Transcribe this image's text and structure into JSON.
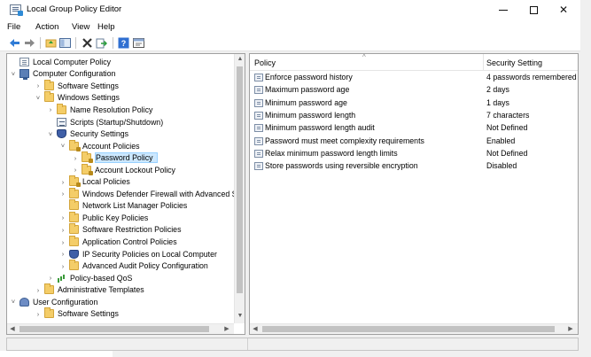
{
  "window": {
    "title": "Local Group Policy Editor",
    "controls": {
      "minimize": "–",
      "close": "✕"
    }
  },
  "menu": [
    "File",
    "Action",
    "View",
    "Help"
  ],
  "toolbar": {
    "icons": [
      "back-arrow-icon",
      "forward-arrow-icon",
      "up-folder-icon",
      "show-hide-tree-icon",
      "delete-icon",
      "export-list-icon",
      "help-icon",
      "properties-icon"
    ],
    "colors": {
      "arrow": "#2f7bd6",
      "help": "#2f6fd1",
      "delete": "#333333"
    }
  },
  "tree": [
    {
      "label": "Local Computer Policy",
      "chevron": "",
      "icon": "doc"
    },
    {
      "label": "Computer Configuration",
      "chevron": "˅",
      "icon": "computer"
    },
    {
      "label": "Software Settings",
      "chevron": "›",
      "icon": "folder"
    },
    {
      "label": "Windows Settings",
      "chevron": "˅",
      "icon": "folder"
    },
    {
      "label": "Name Resolution Policy",
      "chevron": "›",
      "icon": "folder"
    },
    {
      "label": "Scripts (Startup/Shutdown)",
      "chevron": "",
      "icon": "scripts"
    },
    {
      "label": "Security Settings",
      "chevron": "˅",
      "icon": "shield"
    },
    {
      "label": "Account Policies",
      "chevron": "˅",
      "icon": "folder-lock"
    },
    {
      "label": "Password Policy",
      "chevron": "›",
      "icon": "folder-lock"
    },
    {
      "label": "Account Lockout Policy",
      "chevron": "›",
      "icon": "folder-lock"
    },
    {
      "label": "Local Policies",
      "chevron": "›",
      "icon": "folder-lock"
    },
    {
      "label": "Windows Defender Firewall with Advanced Se",
      "chevron": "›",
      "icon": "folder"
    },
    {
      "label": "Network List Manager Policies",
      "chevron": "",
      "icon": "folder"
    },
    {
      "label": "Public Key Policies",
      "chevron": "›",
      "icon": "folder"
    },
    {
      "label": "Software Restriction Policies",
      "chevron": "›",
      "icon": "folder"
    },
    {
      "label": "Application Control Policies",
      "chevron": "›",
      "icon": "folder"
    },
    {
      "label": "IP Security Policies on Local Computer",
      "chevron": "›",
      "icon": "shield"
    },
    {
      "label": "Advanced Audit Policy Configuration",
      "chevron": "›",
      "icon": "folder"
    },
    {
      "label": "Policy-based QoS",
      "chevron": "›",
      "icon": "bars"
    },
    {
      "label": "Administrative Templates",
      "chevron": "›",
      "icon": "folder"
    },
    {
      "label": "User Configuration",
      "chevron": "˅",
      "icon": "user"
    },
    {
      "label": "Software Settings",
      "chevron": "›",
      "icon": "folder"
    }
  ],
  "list": {
    "columns": [
      "Policy",
      "Security Setting"
    ],
    "rows": [
      {
        "policy": "Enforce password history",
        "setting": "4 passwords remembered"
      },
      {
        "policy": "Maximum password age",
        "setting": "2 days"
      },
      {
        "policy": "Minimum password age",
        "setting": "1 days"
      },
      {
        "policy": "Minimum password length",
        "setting": "7 characters"
      },
      {
        "policy": "Minimum password length audit",
        "setting": "Not Defined"
      },
      {
        "policy": "Password must meet complexity requirements",
        "setting": "Enabled"
      },
      {
        "policy": "Relax minimum password length limits",
        "setting": "Not Defined"
      },
      {
        "policy": "Store passwords using reversible encryption",
        "setting": "Disabled"
      }
    ]
  },
  "selection": {
    "tree_label": "Password Policy",
    "highlight": "#cce8ff"
  }
}
